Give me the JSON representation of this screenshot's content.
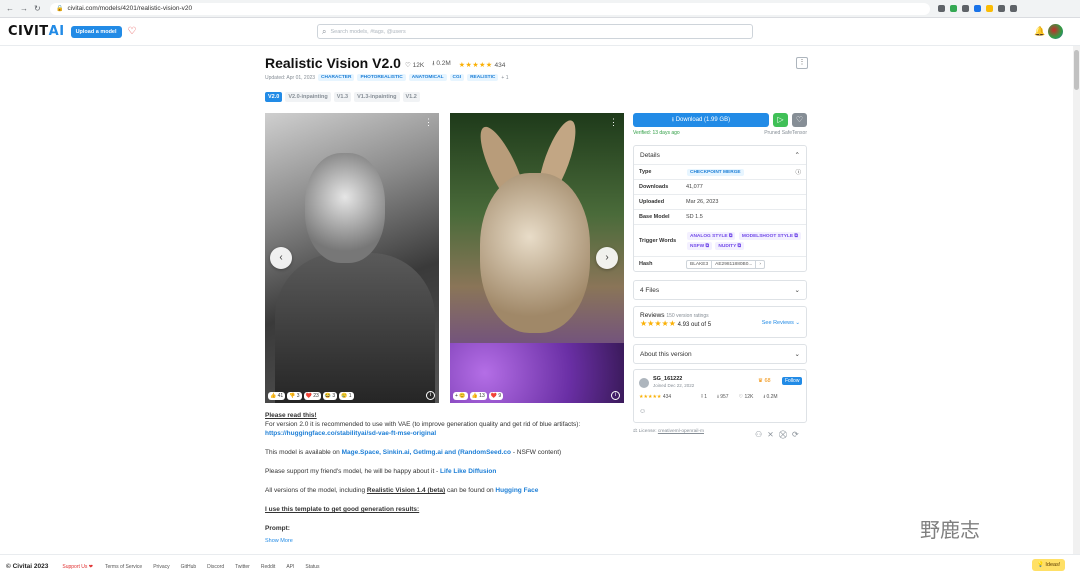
{
  "browser": {
    "url": "civitai.com/models/4201/realistic-vision-v20"
  },
  "header": {
    "logo_main": "CIVIT",
    "logo_accent": "AI",
    "upload_label": "Upload a model",
    "search_placeholder": "Search models, #tags, @users"
  },
  "model": {
    "title": "Realistic Vision V2.0",
    "likes": "12K",
    "downloads": "0.2M",
    "stars": "★★★★★",
    "rating_count": "434",
    "updated": "Updated: Apr 01, 2023",
    "tags": [
      "CHARACTER",
      "PHOTOREALISTIC",
      "ANATOMICAL",
      "CGI",
      "REALISTIC"
    ],
    "more_tags": "+ 1",
    "versions": [
      "V2.0",
      "V2.0-inpainting",
      "V1.3",
      "V1.3-inpainting",
      "V1.2"
    ]
  },
  "gallery": {
    "img1_reacts": [
      "👍 41",
      "👎 3",
      "❤️ 23",
      "😂 3",
      "😢 1"
    ],
    "img2_reacts": [
      "+ 😊",
      "👍 13",
      "❤️ 9"
    ]
  },
  "description": {
    "heading": "Please read this!",
    "line1": "For version 2.0 it is recommended to use with VAE (to improve generation quality and get rid of blue artifacts):",
    "vae_link": "https://huggingface.co/stabilityai/sd-vae-ft-mse-original",
    "available_prefix": "This model is available on ",
    "available_links": "Mage.Space, Sinkin.ai, GetImg.ai and (RandomSeed.co",
    "available_suffix": " - NSFW content)",
    "support_text": "Please support my friend's model, he will be happy about it - ",
    "support_link": "Life Like Diffusion",
    "versions_prefix": "All versions of the model, including ",
    "versions_bold": "Realistic Vision 1.4 (beta)",
    "versions_mid": " can be found on ",
    "versions_link": "Hugging Face",
    "template": "I use this template to get good generation results:",
    "prompt": "Prompt:",
    "show_more": "Show More"
  },
  "sidebar": {
    "download_label": "Download (1.99 GB)",
    "verified": "Verified: 13 days ago",
    "pruned": "Pruned SafeTensor",
    "details_title": "Details",
    "details": {
      "type_label": "Type",
      "type_value": "CHECKPOINT MERGE",
      "downloads_label": "Downloads",
      "downloads_value": "41,077",
      "uploaded_label": "Uploaded",
      "uploaded_value": "Mar 26, 2023",
      "base_label": "Base Model",
      "base_value": "SD 1.5",
      "trigger_label": "Trigger Words",
      "triggers": [
        "ANALOG STYLE",
        "MODELSHOOT STYLE",
        "NSFW",
        "NUDITY"
      ],
      "hash_label": "Hash",
      "hash_algo": "BLAKE3",
      "hash_value": "AE29811880B0..."
    },
    "files": "4 Files",
    "reviews_title": "Reviews",
    "reviews_count": "150 version ratings",
    "reviews_score": "4.93 out of 5",
    "see_reviews": "See Reviews",
    "about": "About this version",
    "author_name": "SG_161222",
    "author_joined": "Joined Dec 22, 2022",
    "author_badge": "68",
    "follow": "Follow",
    "author_rating": "434",
    "author_stats": [
      "1",
      "957",
      "12K",
      "0.2M"
    ],
    "license_label": "License:",
    "license_link": "creativeml-openrail-m"
  },
  "footer": {
    "brand": "© Civitai 2023",
    "support": "Support Us ❤",
    "links": [
      "Terms of Service",
      "Privacy",
      "GitHub",
      "Discord",
      "Twitter",
      "Reddit",
      "API",
      "Status"
    ],
    "ideas": "Ideas!"
  },
  "watermark": "野鹿志"
}
